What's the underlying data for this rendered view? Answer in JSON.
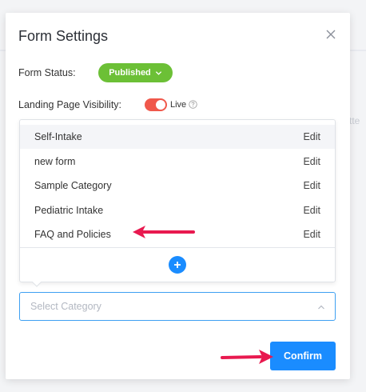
{
  "background": {
    "partial_text": "tte"
  },
  "modal": {
    "title": "Form Settings",
    "close_icon": "close-icon"
  },
  "form_status": {
    "label": "Form Status:",
    "value": "Published",
    "color": "#6cc036"
  },
  "visibility": {
    "label": "Landing Page Visibility:",
    "toggle_on": true,
    "toggle_color": "#f0584b",
    "state_label": "Live"
  },
  "category_dropdown": {
    "items": [
      {
        "name": "Self-Intake",
        "action": "Edit"
      },
      {
        "name": "new form",
        "action": "Edit"
      },
      {
        "name": "Sample Category",
        "action": "Edit"
      },
      {
        "name": "Pediatric Intake",
        "action": "Edit"
      },
      {
        "name": "FAQ and Policies",
        "action": "Edit"
      }
    ],
    "add_icon": "plus-icon"
  },
  "category_select": {
    "placeholder": "Select Category"
  },
  "footer": {
    "confirm_label": "Confirm",
    "accent": "#1a8cff"
  },
  "annotation_color": "#e8194f"
}
